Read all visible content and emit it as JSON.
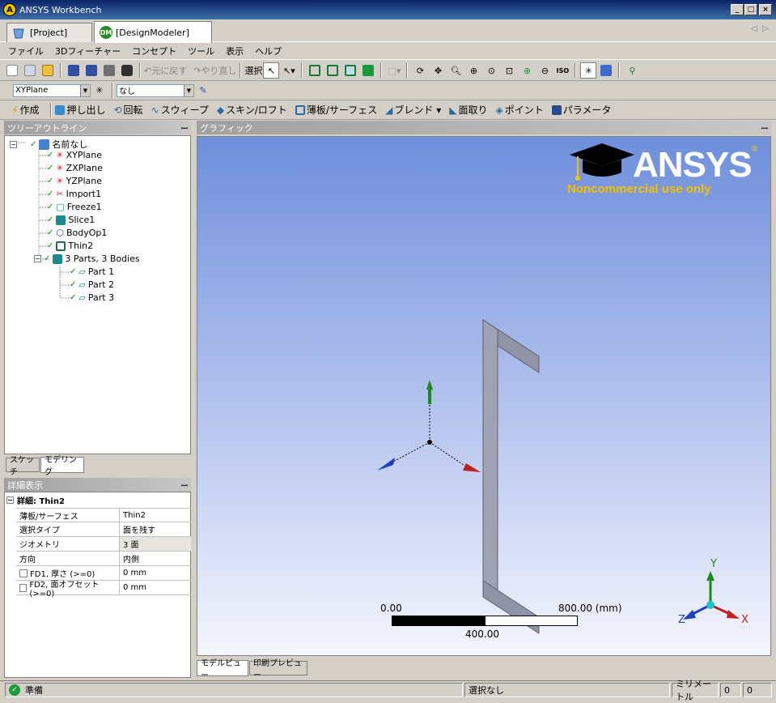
{
  "window": {
    "title": "ANSYS Workbench",
    "logo_letter": "A"
  },
  "tabs": [
    {
      "label": "[Project]"
    },
    {
      "label": "[DesignModeler]",
      "icon_text": "DM"
    }
  ],
  "menu": [
    "ファイル",
    "3Dフィーチャー",
    "コンセプト",
    "ツール",
    "表示",
    "ヘルプ"
  ],
  "toolbar1": {
    "undo": "元に戻す",
    "redo": "やり直し",
    "select": "選択",
    "iso": "ISO"
  },
  "toolbar2": {
    "plane": "XYPlane",
    "sketch": "なし"
  },
  "toolbar3": [
    "作成",
    "押し出し",
    "回転",
    "スウィープ",
    "スキン/ロフト",
    "薄板/サーフェス",
    "ブレンド ▾",
    "面取り",
    "ポイント",
    "パラメータ"
  ],
  "tree": {
    "header": "ツリーアウトライン",
    "items": [
      {
        "label": "名前なし"
      },
      {
        "label": "XYPlane"
      },
      {
        "label": "ZXPlane"
      },
      {
        "label": "YZPlane"
      },
      {
        "label": "Import1"
      },
      {
        "label": "Freeze1"
      },
      {
        "label": "Slice1"
      },
      {
        "label": "BodyOp1"
      },
      {
        "label": "Thin2"
      },
      {
        "label": "3 Parts, 3 Bodies"
      },
      {
        "label": "Part 1"
      },
      {
        "label": "Part 2"
      },
      {
        "label": "Part 3"
      }
    ],
    "tabs": [
      "スケッチ",
      "モデリング"
    ]
  },
  "details": {
    "header": "詳細表示",
    "title": "詳細: Thin2",
    "rows": [
      {
        "key": "薄板/サーフェス",
        "value": "Thin2"
      },
      {
        "key": "選択タイプ",
        "value": "面を残す"
      },
      {
        "key": "ジオメトリ",
        "value": "3 面"
      },
      {
        "key": "方向",
        "value": "内側"
      },
      {
        "key": "FD1, 厚さ (>=0)",
        "value": "0 mm"
      },
      {
        "key": "FD2, 面オフセット (>=0)",
        "value": "0 mm"
      }
    ]
  },
  "graphics": {
    "header": "グラフィック",
    "brand": "ANSYS",
    "brand_sub": "Noncommercial use only",
    "scale_left": "0.00",
    "scale_right": "800.00 (mm)",
    "scale_mid": "400.00",
    "triad": {
      "x": "X",
      "y": "Y",
      "z": "Z"
    },
    "tabs": [
      "モデルビュー",
      "印刷プレビュー"
    ]
  },
  "status": {
    "ready": "準備",
    "selection": "選択なし",
    "units": "ミリメートル",
    "v1": "0",
    "v2": "0"
  }
}
